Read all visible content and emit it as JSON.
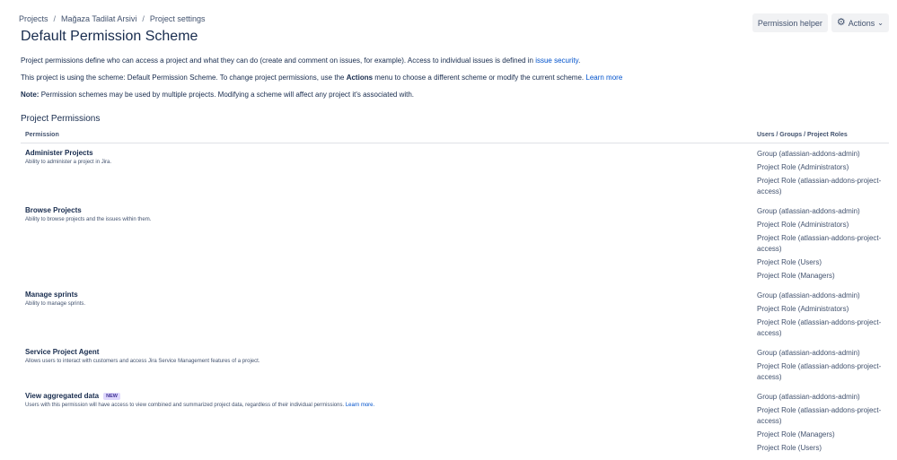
{
  "breadcrumb": {
    "projects": "Projects",
    "project": "Mağaza Tadilat Arsivi",
    "settings": "Project settings",
    "sep": "/"
  },
  "page_title": "Default Permission Scheme",
  "actions": {
    "helper": "Permission helper",
    "actions_label": "Actions",
    "gear_icon": "gear-icon",
    "chevron_icon": "chevron-down-icon"
  },
  "description": {
    "line1_text": "Project permissions define who can access a project and what they can do (create and comment on issues, for example). Access to individual issues is defined in",
    "line1_link": "issue security",
    "line1_end": ".",
    "line2_a": "This project is using the scheme: Default Permission Scheme. To change project permissions, use the",
    "line2_bold": "Actions",
    "line2_b": "menu to choose a different scheme or modify the current scheme.",
    "line2_link": "Learn more",
    "note_label": "Note:",
    "note_text": "Permission schemes may be used by multiple projects. Modifying a scheme will affect any project it's associated with."
  },
  "section_title": "Project Permissions",
  "table": {
    "col_permission": "Permission",
    "col_users": "Users / Groups / Project Roles",
    "rows": [
      {
        "name": "Administer Projects",
        "desc": "Ability to administer a project in Jira.",
        "roles": [
          "Group (atlassian-addons-admin)",
          "Project Role (Administrators)",
          "Project Role (atlassian-addons-project-access)"
        ]
      },
      {
        "name": "Browse Projects",
        "desc": "Ability to browse projects and the issues within them.",
        "roles": [
          "Group (atlassian-addons-admin)",
          "Project Role (Administrators)",
          "Project Role (atlassian-addons-project-access)",
          "Project Role (Users)",
          "Project Role (Managers)"
        ]
      },
      {
        "name": "Manage sprints",
        "desc": "Ability to manage sprints.",
        "roles": [
          "Group (atlassian-addons-admin)",
          "Project Role (Administrators)",
          "Project Role (atlassian-addons-project-access)"
        ]
      },
      {
        "name": "Service Project Agent",
        "desc": "Allows users to interact with customers and access Jira Service Management features of a project.",
        "roles": [
          "Group (atlassian-addons-admin)",
          "Project Role (atlassian-addons-project-access)"
        ]
      },
      {
        "name": "View aggregated data",
        "badge": "NEW",
        "desc": "Users with this permission will have access to view combined and summarized project data, regardless of their individual permissions.",
        "desc_link": "Learn more.",
        "roles": [
          "Group (atlassian-addons-admin)",
          "Project Role (atlassian-addons-project-access)",
          "Project Role (Managers)",
          "Project Role (Users)"
        ]
      }
    ]
  }
}
